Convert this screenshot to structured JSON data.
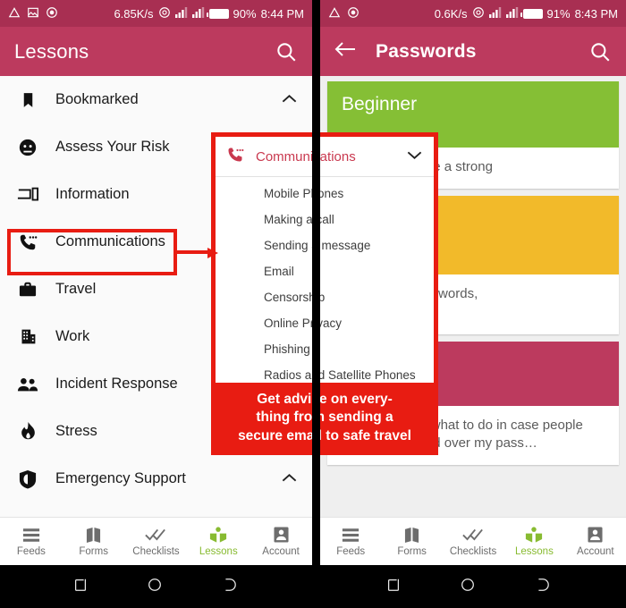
{
  "left_phone": {
    "status_bar": {
      "icons": [
        "warning-triangle-icon",
        "image-icon",
        "record-circle-icon"
      ],
      "network_speed": "6.85K/s",
      "signal_icons": [
        "wifi-icon",
        "signal-bars-icon",
        "signal-bars-2-icon"
      ],
      "battery_percent": "90%",
      "time": "8:44 PM"
    },
    "app_bar": {
      "title": "Lessons",
      "search_icon": "search-icon"
    },
    "drawer": {
      "items": [
        {
          "label": "Bookmarked",
          "icon": "bookmark-icon",
          "chevron": "⌃"
        },
        {
          "label": "Assess Your Risk",
          "icon": "face-icon",
          "chevron": ""
        },
        {
          "label": "Information",
          "icon": "devices-icon",
          "chevron": ""
        },
        {
          "label": "Communications",
          "icon": "phone-dots-icon",
          "chevron": ""
        },
        {
          "label": "Travel",
          "icon": "briefcase-icon",
          "chevron": ""
        },
        {
          "label": "Work",
          "icon": "office-building-icon",
          "chevron": ""
        },
        {
          "label": "Incident Response",
          "icon": "people-icon",
          "chevron": ""
        },
        {
          "label": "Stress",
          "icon": "flame-icon",
          "chevron": ""
        },
        {
          "label": "Emergency Support",
          "icon": "shield-icon",
          "chevron": "⌃"
        }
      ]
    },
    "bottom_nav": {
      "items": [
        {
          "label": "Feeds",
          "icon": "feeds-icon",
          "active": false
        },
        {
          "label": "Forms",
          "icon": "forms-map-icon",
          "active": false
        },
        {
          "label": "Checklists",
          "icon": "checks-icon",
          "active": false
        },
        {
          "label": "Lessons",
          "icon": "book-icon",
          "active": true
        },
        {
          "label": "Account",
          "icon": "person-icon",
          "active": false
        }
      ]
    }
  },
  "right_phone": {
    "status_bar": {
      "icons": [
        "warning-triangle-icon",
        "record-circle-icon"
      ],
      "network_speed": "0.6K/s",
      "signal_icons": [
        "wifi-icon",
        "signal-bars-icon",
        "signal-bars-2-icon"
      ],
      "battery_percent": "91%",
      "time": "8:43 PM"
    },
    "app_bar": {
      "back_icon": "back-arrow-icon",
      "title": "Passwords",
      "search_icon": "search-icon"
    },
    "cards": [
      {
        "title": "Beginner",
        "color": "#85BF35",
        "body": "...w how to make a strong"
      },
      {
        "title": "",
        "color": "#F2BA2A",
        "body": "...too many passwords,\n...ge them."
      },
      {
        "title": "",
        "color": "#BC3A5E",
        "body": "I need to know what to do in case people force me to hand over my pass…"
      }
    ],
    "bottom_nav": {
      "items": [
        {
          "label": "Feeds",
          "icon": "feeds-icon",
          "active": false
        },
        {
          "label": "Forms",
          "icon": "forms-map-icon",
          "active": false
        },
        {
          "label": "Checklists",
          "icon": "checks-icon",
          "active": false
        },
        {
          "label": "Lessons",
          "icon": "book-icon",
          "active": true
        },
        {
          "label": "Account",
          "icon": "person-icon",
          "active": false
        }
      ]
    }
  },
  "overlay": {
    "popup": {
      "header_icon": "phone-dots-icon",
      "header_title": "Communications",
      "header_chevron": "⌄",
      "items": [
        "Mobile Phones",
        "Making a call",
        "Sending a message",
        "Email",
        "Censorship",
        "Online Privacy",
        "Phishing",
        "Radios and Satellite Phones"
      ]
    },
    "caption": "Get advice on every-\nthing from sending a\nsecure email to safe travel",
    "highlight_color": "#E81C12"
  },
  "android_nav": {
    "buttons": [
      "recents-icon",
      "home-icon",
      "back-icon"
    ]
  },
  "theme": {
    "app_bar": "#BC3A5E",
    "status_bar": "#A82F52",
    "accent_green": "#88BB31",
    "card_green": "#85BF35",
    "card_amber": "#F2BA2A",
    "card_crimson": "#BC3A5E",
    "highlight_red": "#E81C12"
  }
}
